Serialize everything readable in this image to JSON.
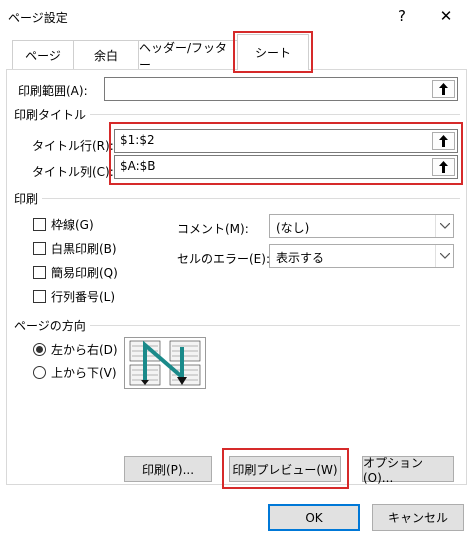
{
  "window": {
    "title": "ページ設定",
    "help_label": "?",
    "close_label": "✕"
  },
  "tabs": [
    {
      "label": "ページ"
    },
    {
      "label": "余白"
    },
    {
      "label": "ヘッダー/フッター"
    },
    {
      "label": "シート",
      "active": true
    }
  ],
  "print_area": {
    "label": "印刷範囲(A):",
    "value": ""
  },
  "print_titles": {
    "group_label": "印刷タイトル",
    "rows_label": "タイトル行(R):",
    "rows_value": "$1:$2",
    "cols_label": "タイトル列(C):",
    "cols_value": "$A:$B"
  },
  "print": {
    "group_label": "印刷",
    "checkboxes": [
      {
        "label": "枠線(G)",
        "checked": false
      },
      {
        "label": "白黒印刷(B)",
        "checked": false
      },
      {
        "label": "簡易印刷(Q)",
        "checked": false
      },
      {
        "label": "行列番号(L)",
        "checked": false
      }
    ],
    "comments_label": "コメント(M):",
    "comments_value": "(なし)",
    "errors_label": "セルのエラー(E):",
    "errors_value": "表示する"
  },
  "page_order": {
    "group_label": "ページの方向",
    "options": [
      {
        "label": "左から右(D)",
        "selected": true
      },
      {
        "label": "上から下(V)",
        "selected": false
      }
    ]
  },
  "buttons": {
    "print": "印刷(P)...",
    "preview": "印刷プレビュー(W)",
    "options": "オプション(O)...",
    "ok": "OK",
    "cancel": "キャンセル"
  },
  "colors": {
    "highlight": "#d62a2a",
    "accent": "#0078d7",
    "preview_arrow": "#1a8a8a"
  }
}
